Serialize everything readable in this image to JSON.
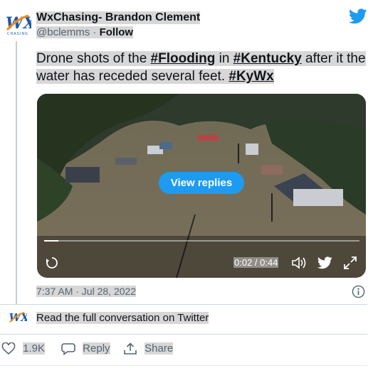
{
  "author": {
    "display_name": "WxChasing- Brandon Clement",
    "handle": "@bclemms",
    "separator": "·",
    "follow_label": "Follow"
  },
  "logo": {
    "main": "WX",
    "sub": "CHASING"
  },
  "tweet": {
    "text_1": "Drone shots of the ",
    "hashtag_1": "#Flooding",
    "text_2": " in ",
    "hashtag_2": "#Kentucky",
    "text_3": " after it the water has receded several feet. ",
    "hashtag_3": "#KyWx"
  },
  "video": {
    "view_replies_label": "View replies",
    "time": "0:02 / 0:44",
    "progress": 0.045
  },
  "timestamp": "7:37 AM · Jul 28, 2022",
  "read_full_label": "Read the full conversation on Twitter",
  "actions": {
    "like_count": "1.9K",
    "reply_label": "Reply",
    "share_label": "Share"
  },
  "colors": {
    "brand_blue": "#1d9bf0",
    "text": "#0f1419",
    "muted": "#536471"
  },
  "icons": [
    "wxchasing-logo",
    "twitter-bird-icon",
    "replay-icon",
    "volume-icon",
    "fullscreen-icon",
    "info-icon",
    "heart-icon",
    "speech-bubble-icon",
    "share-icon"
  ]
}
